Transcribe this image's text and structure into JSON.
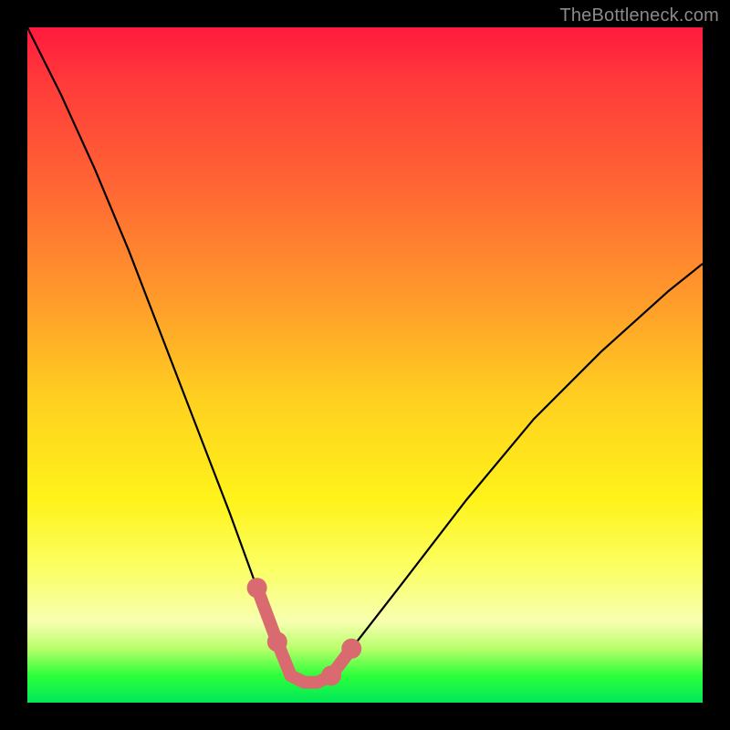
{
  "watermark": "TheBottleneck.com",
  "chart_data": {
    "type": "line",
    "title": "",
    "xlabel": "",
    "ylabel": "",
    "xlim": [
      0,
      100
    ],
    "ylim": [
      0,
      100
    ],
    "grid": false,
    "legend": false,
    "series": [
      {
        "name": "bottleneck-curve",
        "note": "V-shaped black curve; y ≈ 100 at left edge, dips to ≈ 3 near x ≈ 38–44, rises to ≈ 65 at right edge. Values read visually from the gradient-backed plot (no axes shown).",
        "x": [
          0,
          5,
          10,
          15,
          20,
          25,
          30,
          34,
          37,
          39,
          41,
          43,
          45,
          48,
          55,
          65,
          75,
          85,
          95,
          100
        ],
        "y": [
          100,
          90,
          79,
          67,
          54,
          41,
          28,
          17,
          9,
          4,
          3,
          3,
          4,
          8,
          17,
          30,
          42,
          52,
          61,
          65
        ]
      },
      {
        "name": "trough-highlight",
        "note": "Thick salmon-pink overlay tracing the bottom of the V with a few round nodes.",
        "x": [
          34,
          37,
          39,
          41,
          43,
          45,
          48
        ],
        "y": [
          17,
          9,
          4,
          3,
          3,
          4,
          8
        ],
        "nodes_x": [
          34,
          37,
          45,
          48
        ],
        "nodes_y": [
          17,
          9,
          4,
          8
        ]
      }
    ],
    "colors": {
      "curve": "#000000",
      "highlight": "#d96a6f",
      "gradient_top": "#ff1a3e",
      "gradient_mid": "#fff31a",
      "gradient_bottom": "#00e85a"
    }
  }
}
